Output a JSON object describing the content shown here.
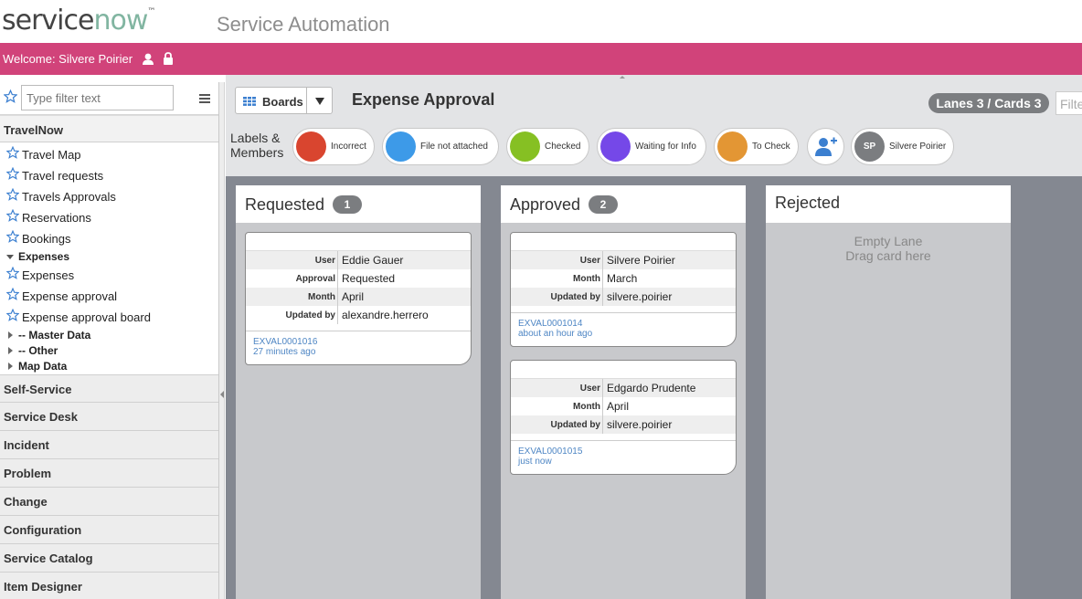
{
  "brand": {
    "logo_service": "service",
    "logo_now": "now",
    "logo_tm": "™",
    "product": "Service Automation"
  },
  "welcome": {
    "text": "Welcome: Silvere Poirier"
  },
  "sidebar": {
    "filter_placeholder": "Type filter text",
    "app": "TravelNow",
    "modules": [
      "Travel Map",
      "Travel requests",
      "Travels Approvals",
      "Reservations",
      "Bookings"
    ],
    "expenses_group": "Expenses",
    "expense_modules": [
      "Expenses",
      "Expense approval",
      "Expense approval board"
    ],
    "subgroups": [
      "-- Master Data",
      "-- Other",
      "Map Data"
    ],
    "sections": [
      "Self-Service",
      "Service Desk",
      "Incident",
      "Problem",
      "Change",
      "Configuration",
      "Service Catalog",
      "Item Designer"
    ]
  },
  "board": {
    "boards_button": "Boards",
    "title": "Expense Approval",
    "stats": "Lanes 3 / Cards 3",
    "filter_placeholder": "Filte",
    "labels_members": "Labels & Members",
    "labels": [
      {
        "name": "Incorrect",
        "color": "#d9452f"
      },
      {
        "name": "File not attached",
        "color": "#3d9ae8"
      },
      {
        "name": "Checked",
        "color": "#86c023"
      },
      {
        "name": "Waiting for Info",
        "color": "#7548e8"
      },
      {
        "name": "To Check",
        "color": "#e39634"
      }
    ],
    "member": {
      "initials": "SP",
      "name": "Silvere Poirier"
    }
  },
  "lanes": [
    {
      "name": "Requested",
      "count": "1"
    },
    {
      "name": "Approved",
      "count": "2"
    },
    {
      "name": "Rejected",
      "empty_line1": "Empty Lane",
      "empty_line2": "Drag card here"
    }
  ],
  "cards": [
    {
      "fields": [
        {
          "k": "User",
          "v": "Eddie Gauer"
        },
        {
          "k": "Approval",
          "v": "Requested"
        },
        {
          "k": "Month",
          "v": "April"
        },
        {
          "k": "Updated by",
          "v": "alexandre.herrero"
        }
      ],
      "number": "EXVAL0001016",
      "time": "27 minutes ago"
    },
    {
      "fields": [
        {
          "k": "User",
          "v": "Silvere Poirier"
        },
        {
          "k": "Month",
          "v": "March"
        },
        {
          "k": "Updated by",
          "v": "silvere.poirier"
        }
      ],
      "number": "EXVAL0001014",
      "time": "about an hour ago"
    },
    {
      "fields": [
        {
          "k": "User",
          "v": "Edgardo Prudente"
        },
        {
          "k": "Month",
          "v": "April"
        },
        {
          "k": "Updated by",
          "v": "silvere.poirier"
        }
      ],
      "number": "EXVAL0001015",
      "time": "just now"
    }
  ]
}
